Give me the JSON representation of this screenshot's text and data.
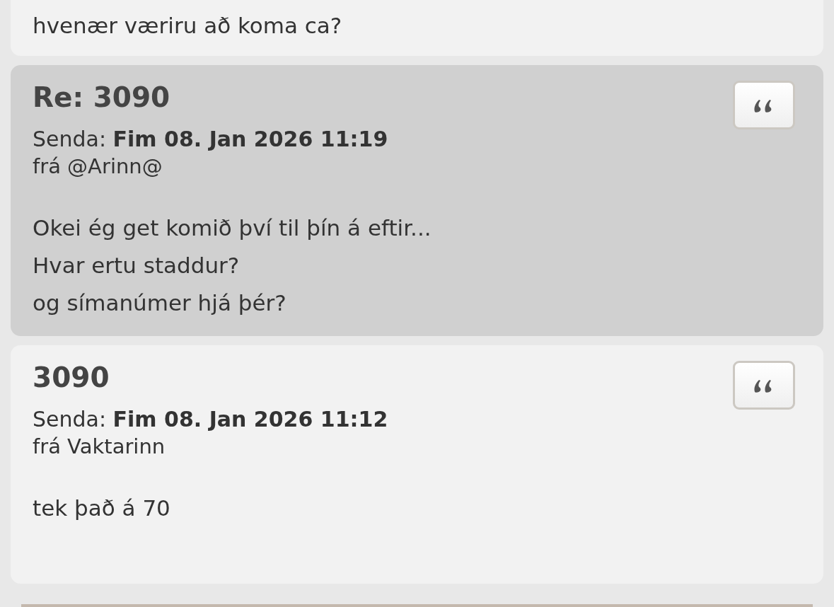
{
  "partial_message": {
    "body": [
      "hvenær væriru að koma ca?"
    ]
  },
  "messages": [
    {
      "title": "Re: 3090",
      "sent": "Senda: **Fim 08. Jan 2026 11:19**",
      "from": "frá @Arinn@",
      "body": [
        "Okei ég get komið því til þín á eftir...",
        "Hvar ertu staddur?",
        "og símanúmer hjá þér?"
      ],
      "selected": true
    },
    {
      "title": "3090",
      "sent": "Senda: **Fim 08. Jan 2026 11:12**",
      "from": "frá Vaktarinn",
      "body": [
        "tek það á 70"
      ],
      "selected": false
    }
  ]
}
